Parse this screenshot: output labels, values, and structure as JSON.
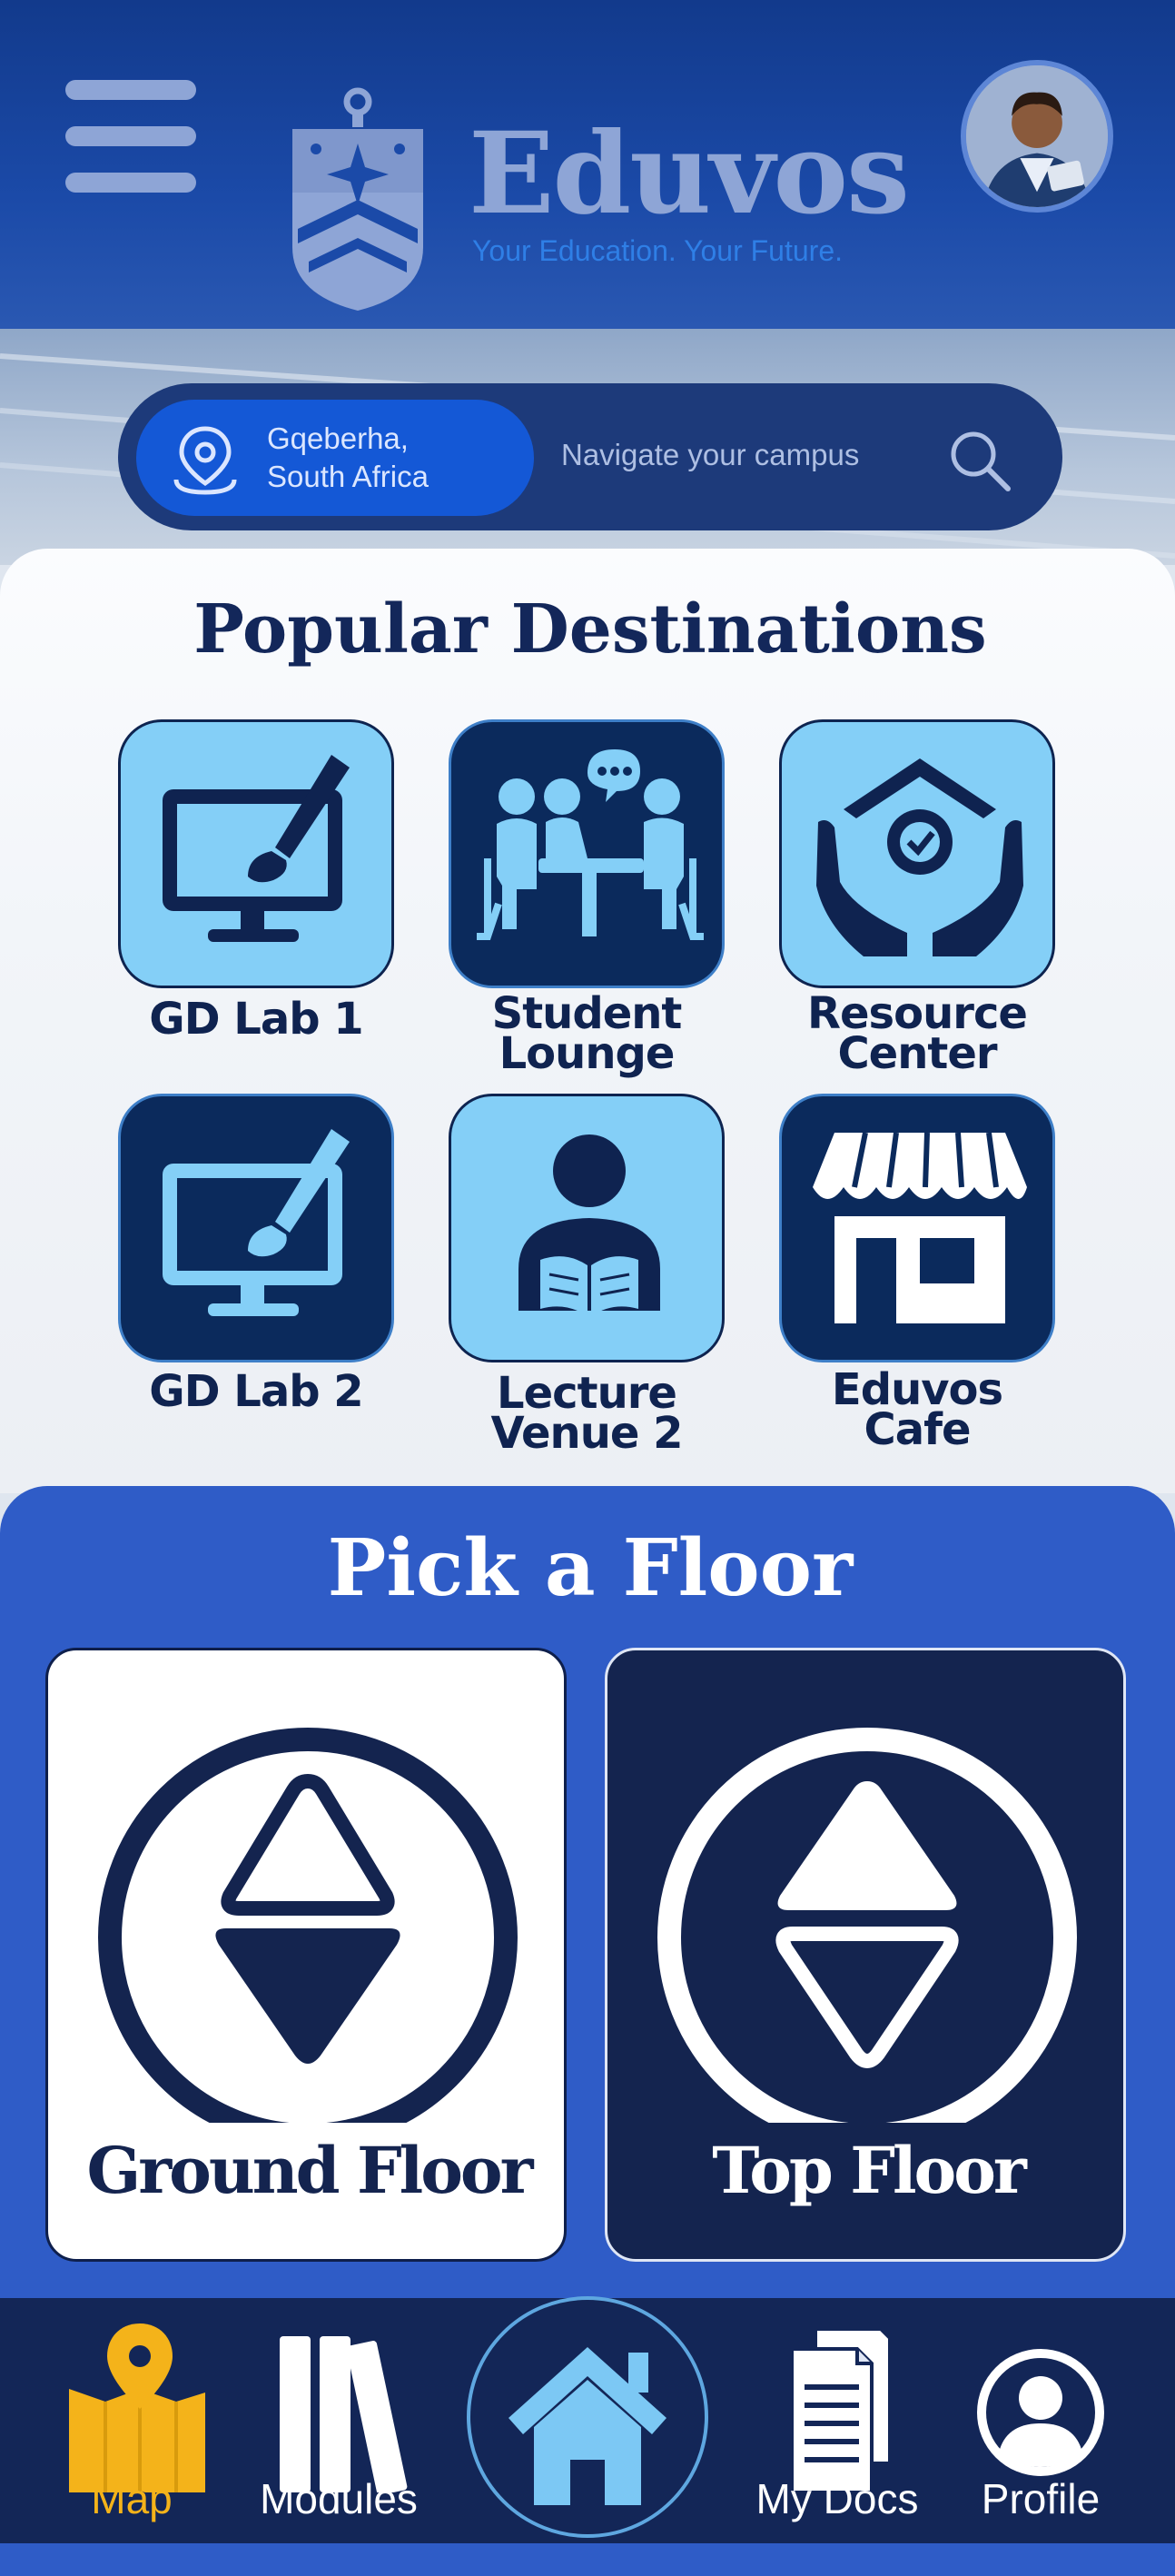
{
  "header": {
    "brand_name": "Eduvos",
    "tagline": "Your Education. Your Future."
  },
  "search": {
    "location_line1": "Gqeberha,",
    "location_line2": "South Africa",
    "placeholder": "Navigate your campus"
  },
  "popular": {
    "title": "Popular Destinations",
    "items": [
      {
        "line1": "GD Lab 1",
        "line2": "",
        "icon": "computer-paintbrush-icon",
        "style": "light"
      },
      {
        "line1": "Student",
        "line2": "Lounge",
        "icon": "group-meeting-icon",
        "style": "dark"
      },
      {
        "line1": "Resource",
        "line2": "Center",
        "icon": "hands-shield-icon",
        "style": "light"
      },
      {
        "line1": "GD Lab 2",
        "line2": "",
        "icon": "computer-paintbrush-icon",
        "style": "dark"
      },
      {
        "line1": "Lecture",
        "line2": "Venue 2",
        "icon": "person-reading-icon",
        "style": "light"
      },
      {
        "line1": "Eduvos",
        "line2": "Cafe",
        "icon": "storefront-icon",
        "style": "dark"
      }
    ]
  },
  "floors": {
    "title": "Pick a Floor",
    "ground_label": "Ground Floor",
    "top_label": "Top Floor"
  },
  "nav": {
    "map": "Map",
    "modules": "Modules",
    "docs": "My Docs",
    "profile": "Profile",
    "active": "map"
  },
  "colors": {
    "header_blue": "#123a8c",
    "tile_light": "#84cff7",
    "tile_dark": "#0b2a5c",
    "floor_panel": "#2f5cc7",
    "nav_bg": "#132657",
    "nav_active": "#f4b31a"
  }
}
